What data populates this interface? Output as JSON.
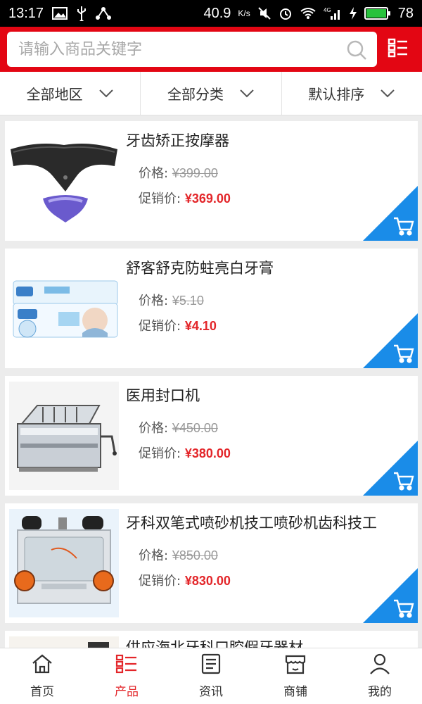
{
  "status_bar": {
    "time": "13:17",
    "battery_text": "40.9",
    "battery_unit": "K/s",
    "network": "4G",
    "battery_level": "78"
  },
  "search": {
    "placeholder": "请输入商品关键字"
  },
  "filters": [
    {
      "label": "全部地区"
    },
    {
      "label": "全部分类"
    },
    {
      "label": "默认排序"
    }
  ],
  "products": [
    {
      "title": "牙齿矫正按摩器",
      "price_label": "价格:",
      "price": "¥399.00",
      "promo_label": "促销价:",
      "promo_price": "¥369.00"
    },
    {
      "title": "舒客舒克防蛀亮白牙膏",
      "price_label": "价格:",
      "price": "¥5.10",
      "promo_label": "促销价:",
      "promo_price": "¥4.10"
    },
    {
      "title": "医用封口机",
      "price_label": "价格:",
      "price": "¥450.00",
      "promo_label": "促销价:",
      "promo_price": "¥380.00"
    },
    {
      "title": "牙科双笔式喷砂机技工喷砂机齿科技工",
      "price_label": "价格:",
      "price": "¥850.00",
      "promo_label": "促销价:",
      "promo_price": "¥830.00"
    },
    {
      "title": "供应海北牙科口腔假牙器材"
    }
  ],
  "bottom_nav": [
    {
      "label": "首页"
    },
    {
      "label": "产品"
    },
    {
      "label": "资讯"
    },
    {
      "label": "商铺"
    },
    {
      "label": "我的"
    }
  ],
  "colors": {
    "brand_red": "#e30613",
    "price_red": "#e3262a",
    "cart_blue": "#1a8ce8"
  },
  "icons": {
    "search": "search-icon",
    "menu": "list-menu-icon",
    "cart": "cart-icon",
    "home": "home-icon",
    "products": "list-icon",
    "news": "news-icon",
    "shop": "shop-icon",
    "profile": "user-icon"
  }
}
